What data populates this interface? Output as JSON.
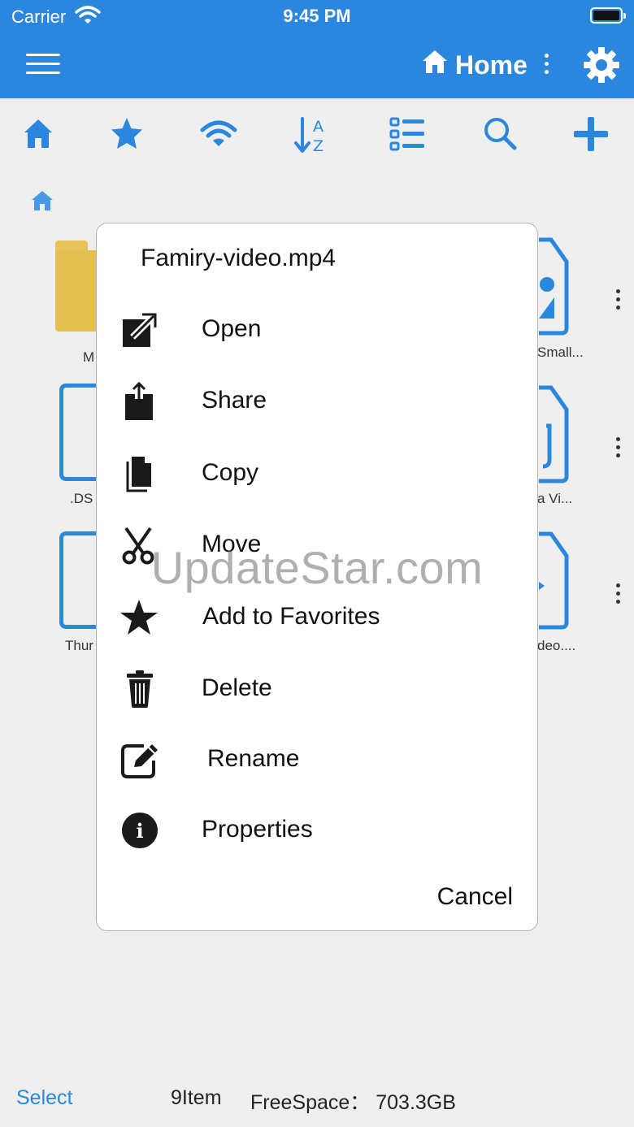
{
  "status_bar": {
    "carrier": "Carrier",
    "time": "9:45 PM"
  },
  "nav": {
    "title": "Home",
    "icons": [
      "menu-icon",
      "home-icon",
      "more-vertical-icon",
      "gear-icon"
    ]
  },
  "toolbar": {
    "icons": [
      "home-icon",
      "star-icon",
      "wifi-icon",
      "sort-az-icon",
      "list-view-icon",
      "search-icon",
      "plus-icon"
    ]
  },
  "files": [
    {
      "label": "M",
      "type": "folder"
    },
    {
      "label": "Small...",
      "type": "image"
    },
    {
      "label": ".DS",
      "type": "file"
    },
    {
      "label": "a Vi...",
      "type": "audio"
    },
    {
      "label": "Thur",
      "type": "file"
    },
    {
      "label": "deo....",
      "type": "video"
    }
  ],
  "dialog": {
    "title": "Famiry-video.mp4",
    "items": [
      {
        "label": "Open",
        "icon": "open-external-icon"
      },
      {
        "label": "Share",
        "icon": "share-icon"
      },
      {
        "label": "Copy",
        "icon": "copy-icon"
      },
      {
        "label": "Move",
        "icon": "scissors-icon"
      },
      {
        "label": "Add to Favorites",
        "icon": "star-icon"
      },
      {
        "label": "Delete",
        "icon": "trash-icon"
      },
      {
        "label": "Rename",
        "icon": "edit-icon"
      },
      {
        "label": "Properties",
        "icon": "info-icon"
      }
    ],
    "cancel": "Cancel"
  },
  "watermark": "UpdateStar.com",
  "bottom_bar": {
    "select": "Select",
    "count": "9Item",
    "free_space": "FreeSpace：  703.3GB"
  },
  "colors": {
    "accent": "#2b86de",
    "folder": "#e2c04f",
    "background": "#efefef"
  }
}
